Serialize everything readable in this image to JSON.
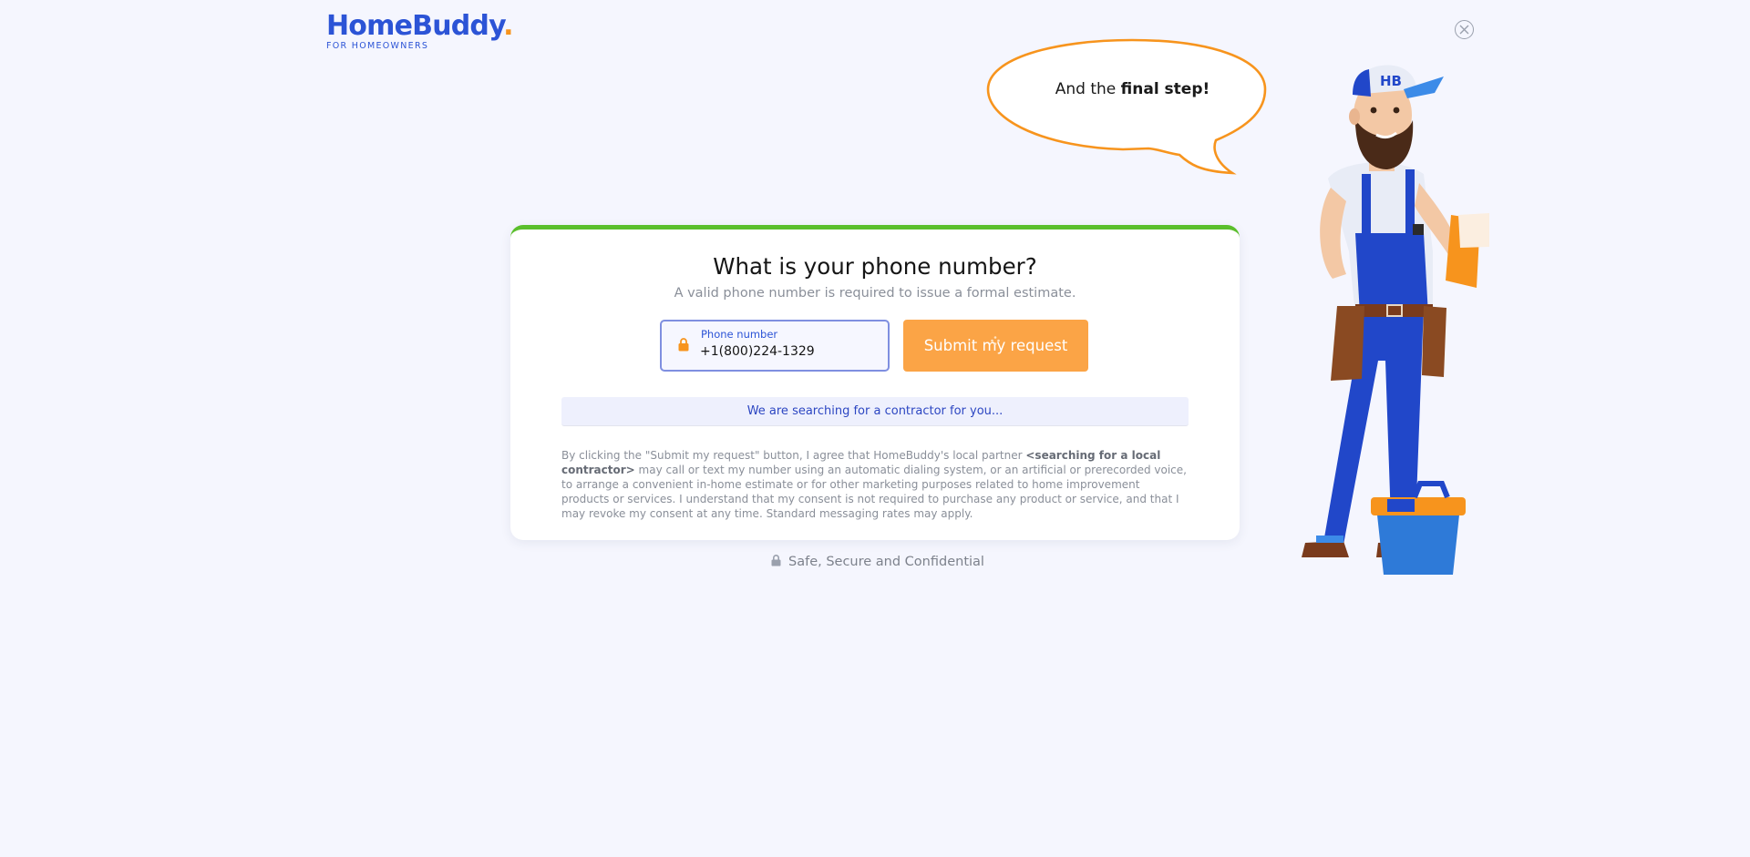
{
  "brand": {
    "name": "HomeBuddy",
    "dot": ".",
    "tagline": "FOR HOMEOWNERS",
    "primary_color": "#2c54d6",
    "accent_color": "#f7941d"
  },
  "header": {
    "close_icon": "close-icon"
  },
  "bubble": {
    "prefix": "And the ",
    "emphasis": "final step!"
  },
  "mascot": {
    "cap_text": "HB"
  },
  "card": {
    "title": "What is your phone number?",
    "subtitle": "A valid phone number is required to issue a formal estimate.",
    "progress_color": "#5bbf2c",
    "phone": {
      "label": "Phone number",
      "value": "+1(800)224-1329",
      "icon": "lock-icon"
    },
    "submit_label": "Submit my request",
    "status": "We are searching for a contractor for you...",
    "consent": {
      "part1": "By clicking the \"Submit my request\" button, I agree that HomeBuddy's local partner ",
      "partner": "<searching for a local contractor>",
      "part2": " may call or text my number using an automatic dialing system, or an artificial or prerecorded voice, to arrange a convenient in-home estimate or for other marketing purposes related to home improvement products or services. I understand that my consent is not required to purchase any product or service, and that I may revoke my consent at any time. Standard messaging rates may apply."
    }
  },
  "footer": {
    "secure_text": "Safe, Secure and Confidential"
  }
}
